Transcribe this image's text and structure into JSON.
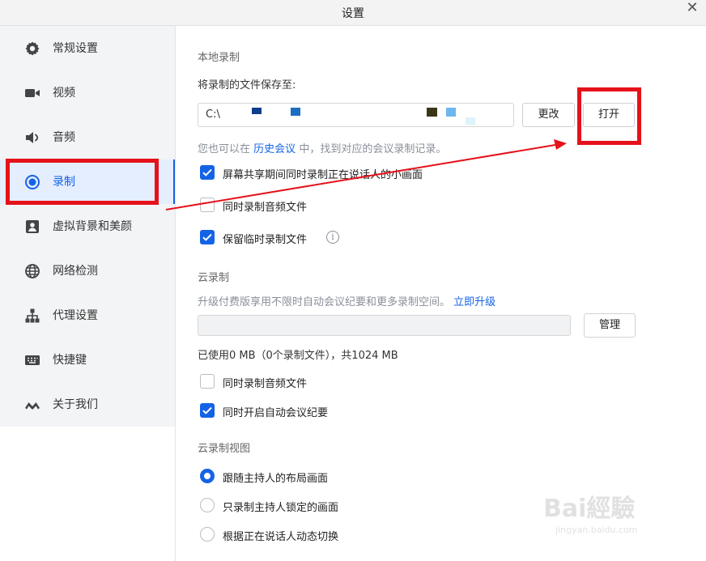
{
  "window": {
    "title": "设置"
  },
  "sidebar": {
    "items": [
      {
        "label": "常规设置",
        "icon": "gear-icon",
        "active": false
      },
      {
        "label": "视频",
        "icon": "video-camera-icon",
        "active": false
      },
      {
        "label": "音频",
        "icon": "speaker-icon",
        "active": false
      },
      {
        "label": "录制",
        "icon": "record-icon",
        "active": true
      },
      {
        "label": "虚拟背景和美颜",
        "icon": "portrait-icon",
        "active": false
      },
      {
        "label": "网络检测",
        "icon": "globe-icon",
        "active": false
      },
      {
        "label": "代理设置",
        "icon": "network-tree-icon",
        "active": false
      },
      {
        "label": "快捷键",
        "icon": "keyboard-icon",
        "active": false
      },
      {
        "label": "关于我们",
        "icon": "logo-wave-icon",
        "active": false
      }
    ],
    "accent_color": "#1463e6"
  },
  "local_recording": {
    "title": "本地录制",
    "save_to_label": "将录制的文件保存至:",
    "path_value": "C:\\",
    "change_button": "更改",
    "open_button": "打开",
    "history_hint_prefix": "您也可以在",
    "history_link": "历史会议",
    "history_hint_suffix": "中，找到对应的会议录制记录。",
    "options": [
      {
        "label": "屏幕共享期间同时录制正在说话人的小画面",
        "checked": true
      },
      {
        "label": "同时录制音频文件",
        "checked": false
      },
      {
        "label": "保留临时录制文件",
        "checked": true
      }
    ]
  },
  "cloud_recording": {
    "title": "云录制",
    "upgrade_hint": "升级付费版享用不限时自动会议纪要和更多录制空间。",
    "upgrade_link": "立即升级",
    "manage_button": "管理",
    "usage_fraction": 0,
    "usage_text": "已使用0 MB（0个录制文件），共1024 MB",
    "options": [
      {
        "label": "同时录制音频文件",
        "checked": false
      },
      {
        "label": "同时开启自动会议纪要",
        "checked": true
      }
    ]
  },
  "cloud_view": {
    "title": "云录制视图",
    "options": [
      {
        "label": "跟随主持人的布局画面",
        "selected": true
      },
      {
        "label": "只录制主持人锁定的画面",
        "selected": false
      },
      {
        "label": "根据正在说话人动态切换",
        "selected": false
      }
    ]
  },
  "watermark": {
    "main": "Bai經驗",
    "sub": "jingyan.baidu.com"
  },
  "annotation_color": "#e5121a"
}
